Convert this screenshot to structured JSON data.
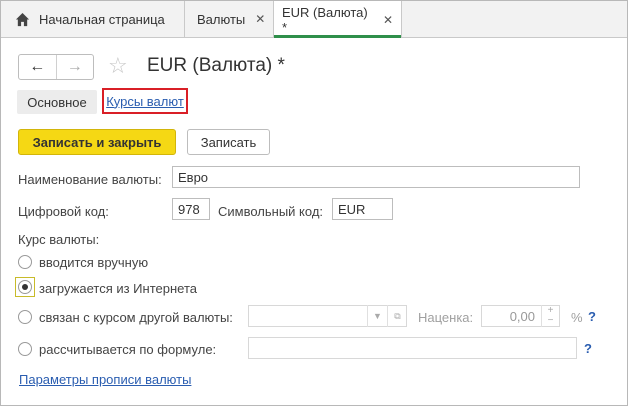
{
  "tabs": [
    {
      "label": "Начальная страница",
      "icon": "home-icon"
    },
    {
      "label": "Валюты",
      "close": "✕"
    },
    {
      "label": "EUR (Валюта) *",
      "close": "✕"
    }
  ],
  "nav": {
    "back": "←",
    "forward": "→",
    "favorite": "☆"
  },
  "form_title": "EUR (Валюта) *",
  "sections": {
    "main": "Основное",
    "rates_link": "Курсы валют"
  },
  "buttons": {
    "save_close": "Записать и закрыть",
    "save": "Записать"
  },
  "fields": {
    "name_label": "Наименование валюты:",
    "name_value": "Евро",
    "digital_code_label": "Цифровой код:",
    "digital_code_value": "978",
    "symbol_code_label": "Символьный код:",
    "symbol_code_value": "EUR"
  },
  "rate": {
    "section_label": "Курс валюты:",
    "options": [
      {
        "label": "вводится вручную",
        "selected": false
      },
      {
        "label": "загружается из Интернета",
        "selected": true
      },
      {
        "label": "связан с курсом другой валюты:",
        "selected": false
      },
      {
        "label": "рассчитывается по формуле:",
        "selected": false
      }
    ],
    "markup_label": "Наценка:",
    "markup_value": "0,00",
    "percent": "%",
    "help": "?"
  },
  "footer_link": "Параметры прописи валюты",
  "colors": {
    "accent_green": "#2f8f4a",
    "save_yellow": "#f5d814",
    "link_blue": "#2a5db0",
    "highlight_red": "#d91f26"
  }
}
